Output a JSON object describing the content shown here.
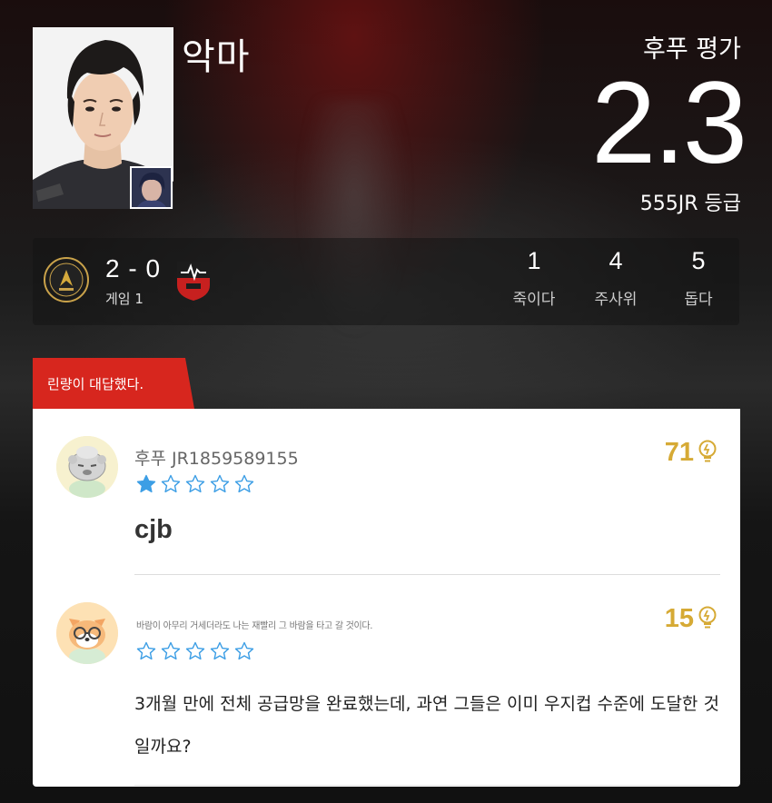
{
  "header": {
    "player_name": "악마",
    "rating_label": "후푸 평가",
    "rating_value": "2.3",
    "grade_label": "555JR 등급"
  },
  "match": {
    "score": "2 - 0",
    "game_label": "게임 1",
    "stats": [
      {
        "value": "1",
        "label": "죽이다"
      },
      {
        "value": "4",
        "label": "주사위"
      },
      {
        "value": "5",
        "label": "돕다"
      }
    ]
  },
  "reply_tab": {
    "label": "린량이 대답했다."
  },
  "comments": [
    {
      "username": "후푸 JR1859589155",
      "rating_stars": 1,
      "max_stars": 5,
      "likes": "71",
      "text": "cjb"
    },
    {
      "motto": "바람이 아무리 거세더라도 나는 재빨리 그 바람을 타고 갈 것이다.",
      "rating_stars": 0,
      "max_stars": 5,
      "likes": "15",
      "text": "3개월 만에 전체 공급망을 완료했는데, 과연 그들은 이미 우지컵 수준에 도달한 것일까요?"
    }
  ],
  "colors": {
    "accent_red": "#d7261e",
    "likes_gold": "#d6aa35",
    "star_blue": "#3c9ee5"
  },
  "icons": {
    "like": "lightbulb-icon",
    "star": "star-icon"
  }
}
